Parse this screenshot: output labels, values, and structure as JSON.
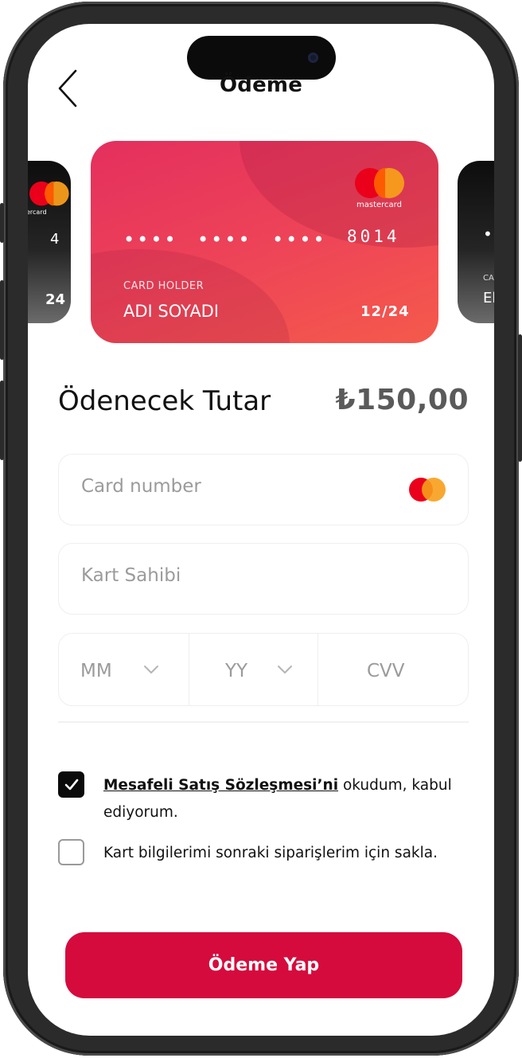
{
  "header": {
    "title": "Ödeme",
    "back_icon": "chevron-left-icon"
  },
  "cards": {
    "main": {
      "brand": "mastercard",
      "masked_groups": [
        "••••",
        "••••",
        "••••"
      ],
      "last_four": "8014",
      "holder_label": "CARD HOLDER",
      "holder_name": "ADI SOYADI",
      "expiry": "12/24",
      "gradient_colors": [
        "#e42f5e",
        "#f55a4b"
      ]
    },
    "left_peek": {
      "brand": "mastercard",
      "number_fragment": "4",
      "expiry_fragment": "24"
    },
    "right_peek": {
      "dots_fragment": "•",
      "holder_label_fragment": "CA",
      "holder_name_fragment": "El"
    }
  },
  "amount": {
    "label": "Ödenecek Tutar",
    "value": "₺150,00"
  },
  "form": {
    "card_number_placeholder": "Card number",
    "card_holder_placeholder": "Kart Sahibi",
    "month_placeholder": "MM",
    "year_placeholder": "YY",
    "cvv_placeholder": "CVV"
  },
  "agreements": {
    "terms_link": "Mesafeli Satış Sözleşmesi’ni",
    "terms_rest_line1": "okudum, kabul",
    "terms_rest_line2": "ediyorum.",
    "terms_checked": true,
    "save_card_text": "Kart bilgilerimi sonraki siparişlerim için sakla.",
    "save_card_checked": false
  },
  "actions": {
    "pay_label": "Ödeme Yap"
  },
  "colors": {
    "accent": "#d50b3d",
    "mastercard_red": "#eb001b",
    "mastercard_orange": "#f79e1b"
  }
}
